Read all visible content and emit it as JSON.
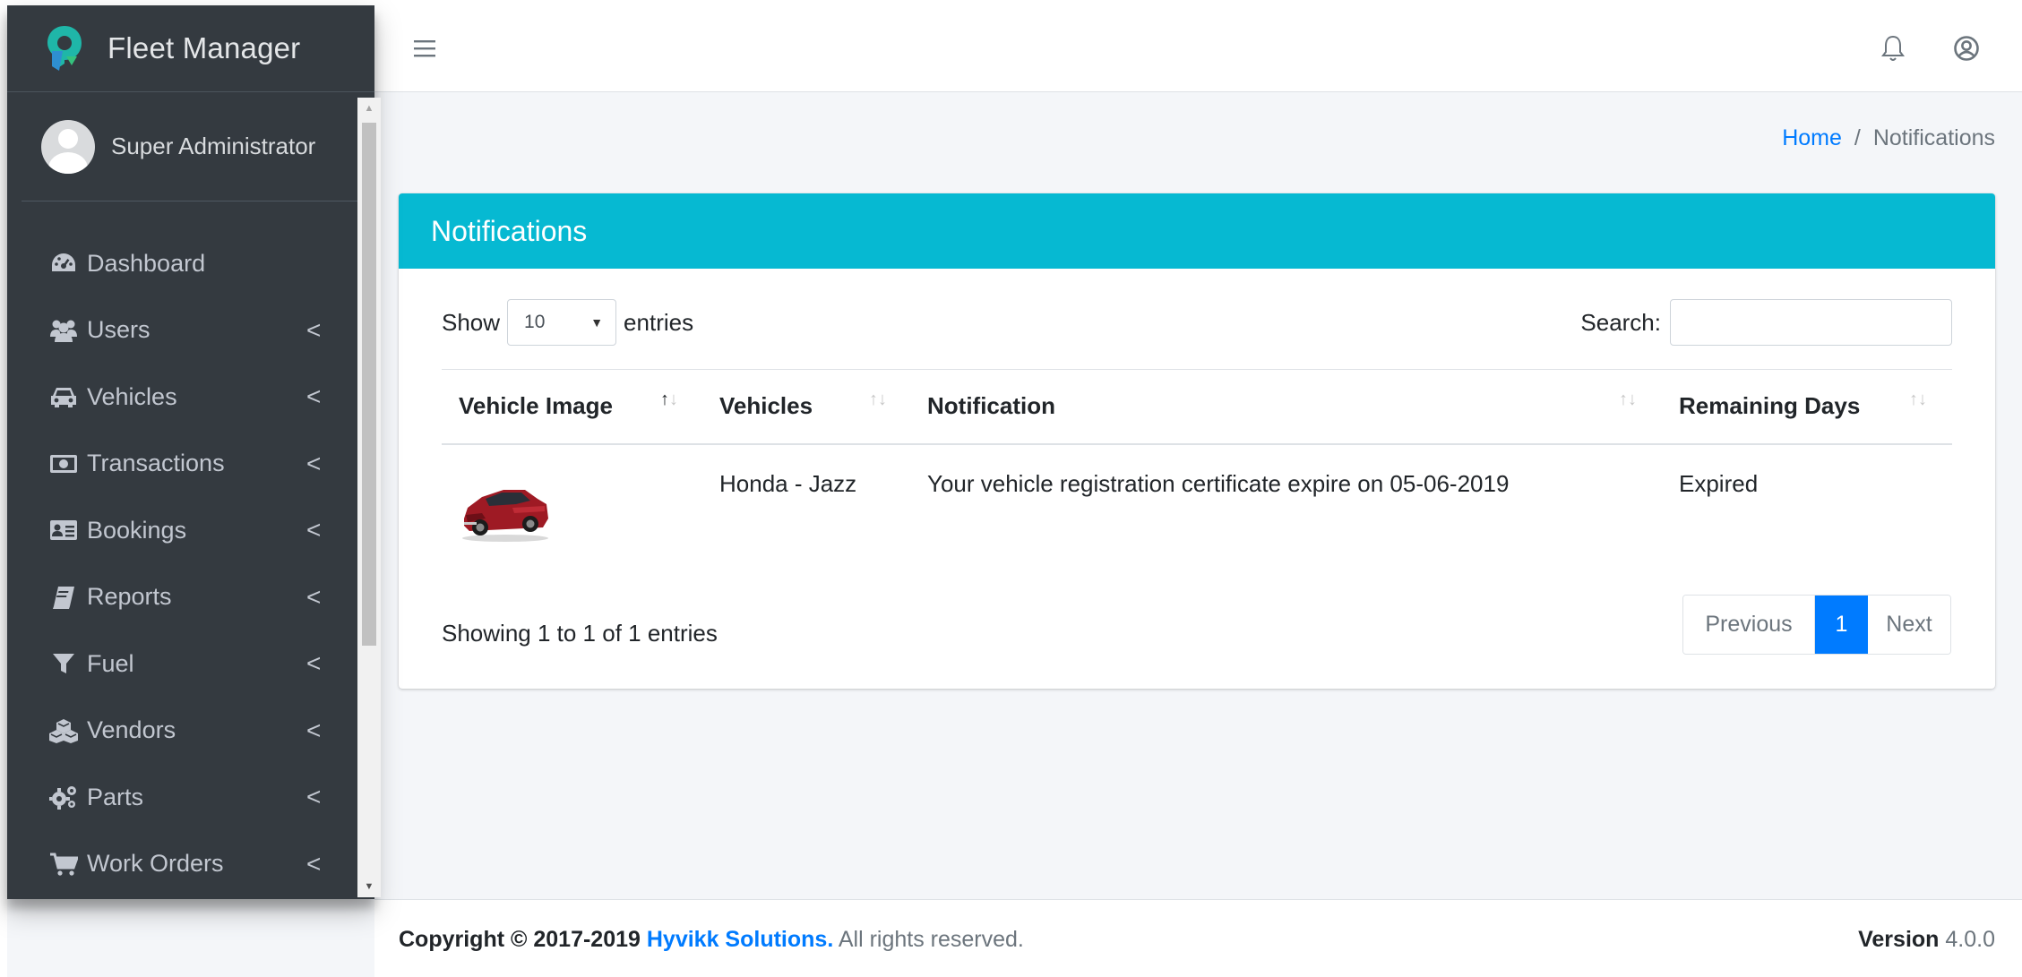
{
  "brand": {
    "name": "Fleet Manager"
  },
  "user": {
    "name": "Super Administrator"
  },
  "sidebar": {
    "items": [
      {
        "label": "Dashboard",
        "icon": "dashboard-icon",
        "has_children": false
      },
      {
        "label": "Users",
        "icon": "users-icon",
        "has_children": true
      },
      {
        "label": "Vehicles",
        "icon": "car-icon",
        "has_children": true
      },
      {
        "label": "Transactions",
        "icon": "money-icon",
        "has_children": true
      },
      {
        "label": "Bookings",
        "icon": "address-card-icon",
        "has_children": true
      },
      {
        "label": "Reports",
        "icon": "book-icon",
        "has_children": true
      },
      {
        "label": "Fuel",
        "icon": "filter-icon",
        "has_children": true
      },
      {
        "label": "Vendors",
        "icon": "cubes-icon",
        "has_children": true
      },
      {
        "label": "Parts",
        "icon": "gears-icon",
        "has_children": true
      },
      {
        "label": "Work Orders",
        "icon": "cart-icon",
        "has_children": true
      }
    ],
    "chevron": "<"
  },
  "topbar": {
    "menu_icon": "hamburger-icon",
    "bell_icon": "bell-icon",
    "account_icon": "account-icon"
  },
  "breadcrumb": {
    "home": "Home",
    "separator": "/",
    "current": "Notifications"
  },
  "card": {
    "title": "Notifications",
    "length": {
      "show_label": "Show",
      "value": "10",
      "entries_label": "entries"
    },
    "search": {
      "label": "Search:",
      "value": "",
      "placeholder": ""
    },
    "table": {
      "columns": [
        "Vehicle Image",
        "Vehicles",
        "Notification",
        "Remaining Days"
      ],
      "rows": [
        {
          "vehicle_image": "red-car-image",
          "vehicle": "Honda - Jazz",
          "notification": "Your vehicle registration certificate expire on 05-06-2019",
          "remaining_days": "Expired"
        }
      ]
    },
    "info": "Showing 1 to 1 of 1 entries",
    "pagination": {
      "previous": "Previous",
      "current": "1",
      "next": "Next"
    }
  },
  "footer": {
    "copyright_prefix": "Copyright © 2017-2019",
    "company": "Hyvikk Solutions.",
    "rights": "All rights reserved.",
    "version_label": "Version",
    "version_value": "4.0.0"
  },
  "colors": {
    "sidebar_bg": "#343a40",
    "header_accent": "#06b9d2",
    "link": "#007bff",
    "expired": "#e74c4c"
  }
}
